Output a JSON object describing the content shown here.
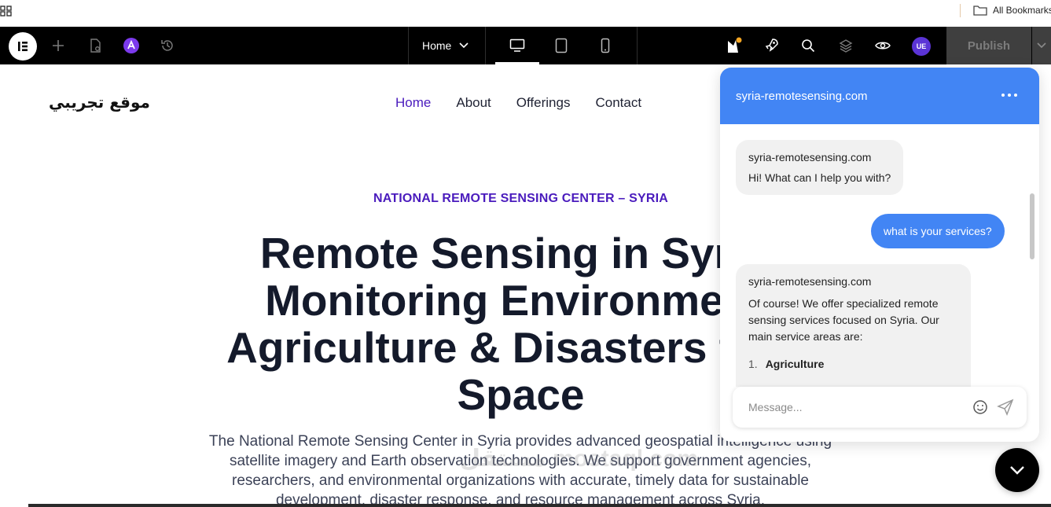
{
  "bookmarks": {
    "all_bookmarks": "All Bookmarks"
  },
  "toolbar": {
    "page_select": "Home",
    "user_initials": "UE",
    "publish_label": "Publish"
  },
  "site": {
    "logo": "موقع تجريبي",
    "nav": [
      "Home",
      "About",
      "Offerings",
      "Contact"
    ]
  },
  "hero": {
    "eyebrow": "NATIONAL REMOTE SENSING CENTER – SYRIA",
    "title_lines": [
      "Remote Sensing in Syria:",
      "Monitoring Environment,",
      "Agriculture & Disasters from",
      "Space"
    ],
    "description": "The National Remote Sensing Center in Syria provides advanced geospatial intelligence using satellite imagery and Earth observation technologies. We support government agencies, researchers, and environmental organizations with accurate, timely data for sustainable development, disaster response, and resource management across Syria.",
    "watermark": "مستقل mostaql.com"
  },
  "chat": {
    "header_title": "syria-remotesensing.com",
    "messages": [
      {
        "sender": "syria-remotesensing.com",
        "text": "Hi! What can I help you with?"
      },
      {
        "user_text": "what is your services?"
      },
      {
        "sender": "syria-remotesensing.com",
        "text": "Of course! We offer specialized remote sensing services focused on Syria. Our main service areas are:",
        "list_first": "Agriculture"
      }
    ],
    "input_placeholder": "Message..."
  },
  "colors": {
    "accent": "#4a1bbd",
    "chat_blue": "#4285f4",
    "toolbar_bg": "#000000"
  }
}
